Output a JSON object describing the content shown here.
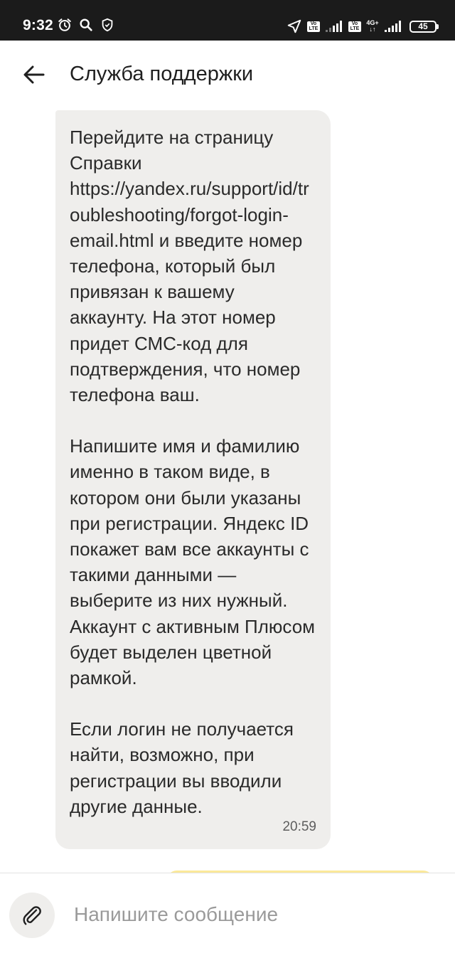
{
  "status_bar": {
    "time": "9:32",
    "icons": [
      "alarm-icon",
      "search-icon",
      "shield-icon",
      "location-arrow-icon",
      "volte-icon",
      "signal-icon",
      "volte-icon",
      "network-4g-icon",
      "signal-icon",
      "battery-icon"
    ],
    "volte_top": "Vo",
    "volte_bottom": "LTE",
    "network_top": "4G+",
    "network_bottom": "↓↑",
    "battery_level": "45"
  },
  "header": {
    "back_icon": "arrow-left-icon",
    "title": "Служба поддержки"
  },
  "conversation": {
    "incoming_message": {
      "paragraphs": [
        "Перейдите на страницу Справки https://yandex.ru/support/id/troubleshooting/forgot-login-email.html и введите номер телефона, который был привязан к вашему аккаунту. На этот номер придет СМС-код для подтверждения, что номер телефона ваш.",
        "Напишите имя и фамилию именно в таком виде, в котором они были указаны при регистрации. Яндекс ID покажет вам все аккаунты с такими данными — выберите из них нужный. Аккаунт с активным Плюсом будет выделен цветной рамкой.",
        "Если логин не получается найти, возможно, при регистрации вы вводили другие данные."
      ],
      "time": "20:59"
    }
  },
  "composer": {
    "attach_icon": "paperclip-icon",
    "placeholder": "Напишите сообщение",
    "value": ""
  },
  "colors": {
    "status_bar_bg": "#1b1b1b",
    "incoming_bubble": "#efeeec",
    "outgoing_bubble": "#fbe99a",
    "placeholder": "#9a9a9a"
  }
}
